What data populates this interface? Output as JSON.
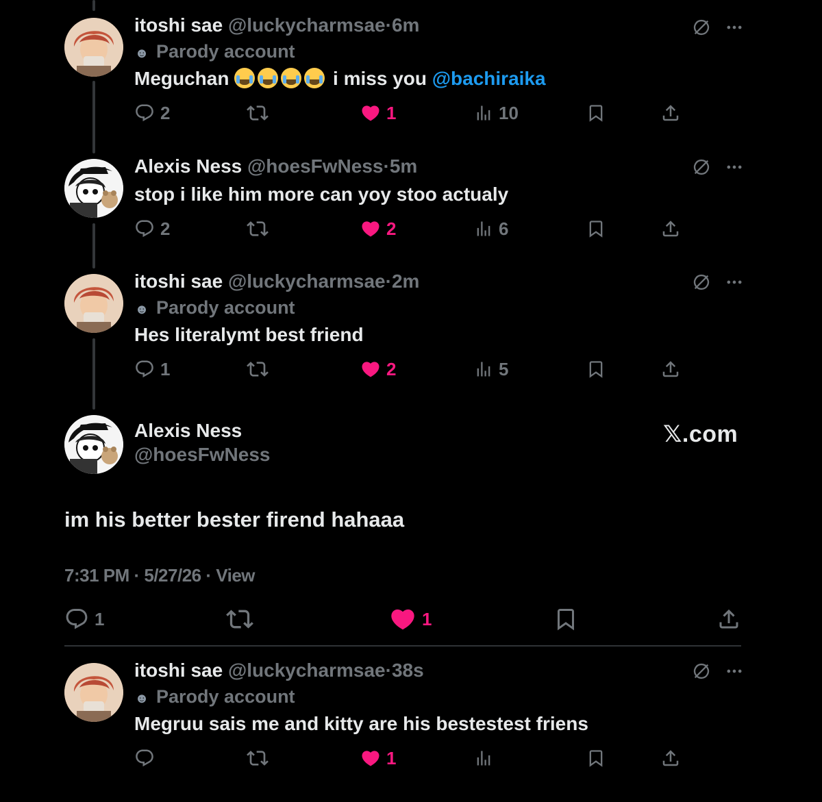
{
  "colors": {
    "background": "#000000",
    "text": "#e7e9ea",
    "muted": "#71767b",
    "link": "#1d9bf0",
    "like": "#f91880",
    "thread_line": "#333639"
  },
  "replies_above": [
    {
      "name": "itoshi sae",
      "handle": "@luckycharmsae",
      "dot": "·",
      "time": "6m",
      "parody_label": "Parody account",
      "text_before": "Meguchan",
      "emoji_count": 4,
      "text_after": "i miss you",
      "mention": "@bachiraika",
      "replies": "2",
      "likes": "1",
      "views": "10"
    },
    {
      "name": "Alexis Ness",
      "handle": "@hoesFwNess",
      "dot": "·",
      "time": "5m",
      "text": "stop i like him more can yoy stoo actualy",
      "replies": "2",
      "likes": "2",
      "views": "6"
    },
    {
      "name": "itoshi sae",
      "handle": "@luckycharmsae",
      "dot": "·",
      "time": "2m",
      "parody_label": "Parody account",
      "text": "Hes literalymt best friend",
      "replies": "1",
      "likes": "2",
      "views": "5"
    }
  ],
  "main_tweet": {
    "name": "Alexis Ness",
    "handle": "@hoesFwNess",
    "brand": "𝕏.com",
    "text": "im his better bester firend hahaaa",
    "timestamp": "7:31 PM · 5/27/26 · View",
    "replies": "1",
    "likes": "1"
  },
  "reply_below": {
    "name": "itoshi sae",
    "handle": "@luckycharmsae",
    "dot": "·",
    "time": "38s",
    "parody_label": "Parody account",
    "text": "Megruu sais me and kitty are his bestestest friens",
    "likes": "1"
  },
  "icons": [
    "reply-icon",
    "retweet-icon",
    "heart-icon",
    "views-icon",
    "bookmark-icon",
    "share-icon",
    "grok-icon",
    "more-icon",
    "parody-mask-icon"
  ]
}
